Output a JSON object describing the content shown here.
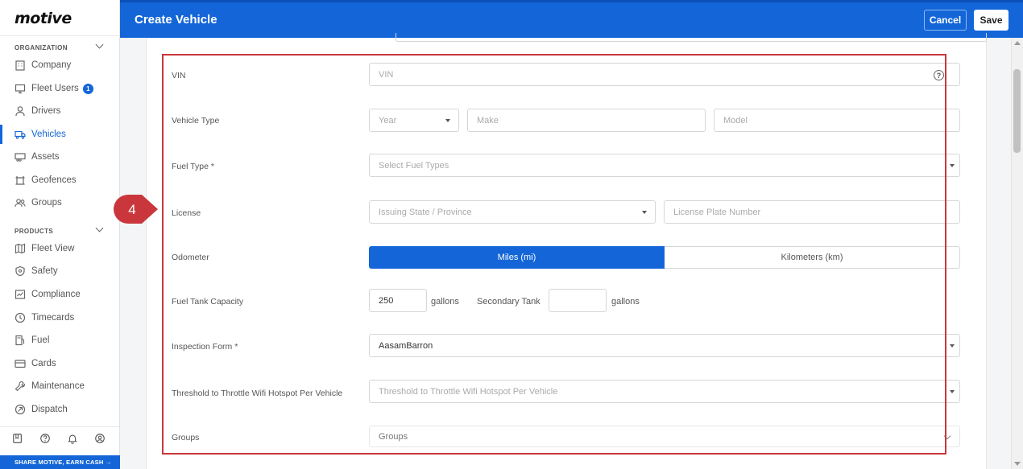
{
  "sidebar": {
    "logo": "motive",
    "org_section": "ORGANIZATION",
    "org_items": [
      {
        "label": "Company",
        "icon": "building-icon"
      },
      {
        "label": "Fleet Users",
        "icon": "monitor-icon",
        "badge": "1"
      },
      {
        "label": "Drivers",
        "icon": "user-icon"
      },
      {
        "label": "Vehicles",
        "icon": "truck-icon",
        "active": true
      },
      {
        "label": "Assets",
        "icon": "trailer-icon"
      },
      {
        "label": "Geofences",
        "icon": "geofence-icon"
      },
      {
        "label": "Groups",
        "icon": "users-icon"
      }
    ],
    "products_section": "PRODUCTS",
    "product_items": [
      {
        "label": "Fleet View",
        "icon": "map-icon"
      },
      {
        "label": "Safety",
        "icon": "shield-icon"
      },
      {
        "label": "Compliance",
        "icon": "clipboard-icon"
      },
      {
        "label": "Timecards",
        "icon": "clock-icon"
      },
      {
        "label": "Fuel",
        "icon": "fuel-icon"
      },
      {
        "label": "Cards",
        "icon": "card-icon"
      },
      {
        "label": "Maintenance",
        "icon": "wrench-icon"
      },
      {
        "label": "Dispatch",
        "icon": "dispatch-icon"
      }
    ],
    "share": "SHARE MOTIVE, EARN CASH →"
  },
  "header": {
    "title": "Create Vehicle",
    "cancel": "Cancel",
    "save": "Save",
    "color": "#1466d8"
  },
  "form": {
    "vin": {
      "label": "VIN",
      "placeholder": "VIN"
    },
    "vehicle_type": {
      "label": "Vehicle Type",
      "year": "Year",
      "make": "Make",
      "model": "Model"
    },
    "fuel_type": {
      "label": "Fuel Type *",
      "placeholder": "Select Fuel Types"
    },
    "license": {
      "label": "License",
      "state": "Issuing State / Province",
      "plate": "License Plate Number"
    },
    "odometer": {
      "label": "Odometer",
      "miles": "Miles (mi)",
      "km": "Kilometers (km)",
      "selected": "Miles (mi)"
    },
    "fuel_tank": {
      "label": "Fuel Tank Capacity",
      "value": "250",
      "unit": "gallons",
      "secondary_label": "Secondary Tank",
      "secondary_value": "",
      "secondary_unit": "gallons"
    },
    "inspection": {
      "label": "Inspection Form *",
      "value": "AasamBarron"
    },
    "threshold": {
      "label": "Threshold to Throttle Wifi Hotspot Per Vehicle",
      "placeholder": "Threshold to Throttle Wifi Hotspot Per Vehicle"
    },
    "groups": {
      "label": "Groups",
      "placeholder": "Groups"
    }
  },
  "annotation": {
    "step": "4",
    "highlight_color": "#c9373c"
  }
}
